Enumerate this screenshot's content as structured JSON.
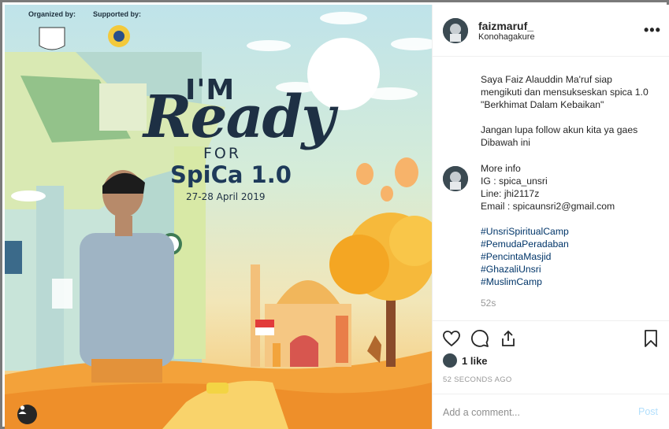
{
  "poster": {
    "organized_label": "Organized by:",
    "supported_label": "Supported by:",
    "title_im": "I'M",
    "title_ready": "Ready",
    "title_for": "FOR",
    "title_spica": "SpiCa 1.0",
    "title_date": "27-28 April 2019",
    "colors": {
      "navy": "#1e3044",
      "sun": "#ffffff",
      "ground": "#f3a23a",
      "tree": "#f6b93b"
    }
  },
  "post": {
    "username": "faizmaruf_",
    "location": "Konohagakure",
    "more_icon": "more-horizontal-icon",
    "caption": {
      "p1": "Saya Faiz Alauddin Ma'ruf siap mengikuti dan mensukseskan spica 1.0 \"Berkhimat Dalam Kebaikan\"",
      "p2": "Jangan lupa follow akun kita ya gaes Dibawah ini"
    },
    "comment": {
      "more_info": "More info",
      "ig": "IG : spica_unsri",
      "line": "Line: jhi2117z",
      "email": "Email : spicaunsri2@gmail.com",
      "hashtags": [
        "#UnsriSpiritualCamp",
        "#PemudaPeradaban",
        "#PencintaMasjid",
        "#GhazaliUnsri",
        "#MuslimCamp"
      ],
      "time": "52s"
    },
    "likes": "1 like",
    "timestamp": "52 SECONDS AGO",
    "add_comment_placeholder": "Add a comment...",
    "post_button": "Post",
    "link_color": "#003569",
    "post_button_color": "#b2dffc"
  }
}
